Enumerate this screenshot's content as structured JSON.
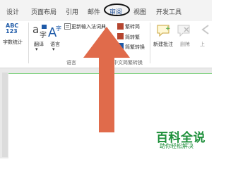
{
  "tabs": [
    {
      "label": "设计"
    },
    {
      "label": "页面布局"
    },
    {
      "label": "引用"
    },
    {
      "label": "邮件"
    },
    {
      "label": "审阅",
      "active": true
    },
    {
      "label": "视图"
    },
    {
      "label": "开发工具"
    }
  ],
  "ribbon": {
    "proofing": {
      "abc_icon_text": "ABC\n123",
      "word_count": "字数统计"
    },
    "language": {
      "translate": "翻译",
      "language": "语言",
      "update_ime": "更新输入法词典",
      "group_label": "语言"
    },
    "chinese": {
      "trad_to_simp": "繁转简",
      "simp_to_trad": "简转繁",
      "convert": "简繁转换",
      "group_label": "中文简繁转换"
    },
    "comments": {
      "new_comment": "新建批注",
      "delete": "删除"
    }
  },
  "watermark": {
    "title": "百科全说",
    "subtitle": "助你轻松解决"
  },
  "colors": {
    "accent": "#2b579a",
    "arrow": "#e06b4b",
    "watermark": "#1d8f3a"
  }
}
